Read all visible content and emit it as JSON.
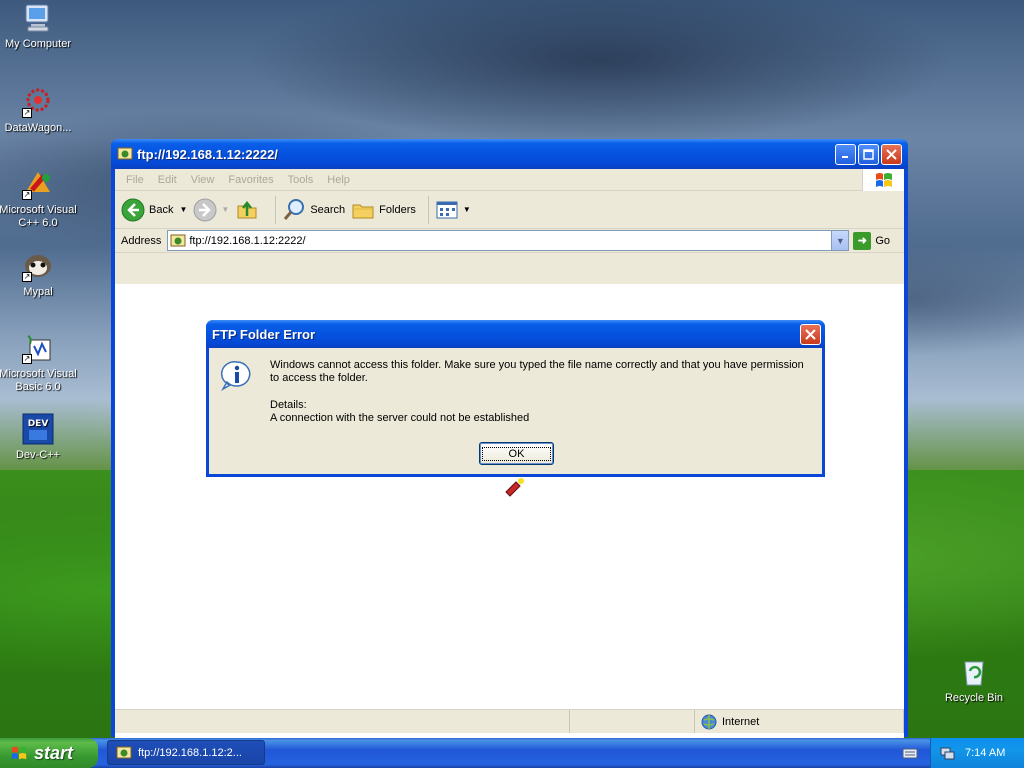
{
  "desktop": {
    "icons": [
      {
        "label": "My Computer"
      },
      {
        "label": "DataWagon..."
      },
      {
        "label": "Microsoft Visual C++ 6.0"
      },
      {
        "label": "Mypal"
      },
      {
        "label": "Microsoft Visual Basic 6.0"
      },
      {
        "label": "Dev-C++"
      },
      {
        "label": "Recycle Bin"
      }
    ]
  },
  "window": {
    "title": "ftp://192.168.1.12:2222/",
    "menu": [
      "File",
      "Edit",
      "View",
      "Favorites",
      "Tools",
      "Help"
    ],
    "toolbar": {
      "back": "Back",
      "search": "Search",
      "folders": "Folders"
    },
    "address": {
      "label": "Address",
      "value": "ftp://192.168.1.12:2222/",
      "go": "Go"
    },
    "status": {
      "zone": "Internet"
    }
  },
  "dialog": {
    "title": "FTP Folder Error",
    "message": "Windows cannot access this folder. Make sure you typed the file name correctly and that you have permission to access the folder.",
    "details_label": "Details:",
    "details_text": "A connection with the server could not be established",
    "ok": "OK"
  },
  "taskbar": {
    "start": "start",
    "task": "ftp://192.168.1.12:2...",
    "clock": "7:14 AM"
  },
  "colors": {
    "xp_blue": "#0a47d8",
    "start_green": "#3c9a3c",
    "tray_blue": "#0c8ff0"
  }
}
